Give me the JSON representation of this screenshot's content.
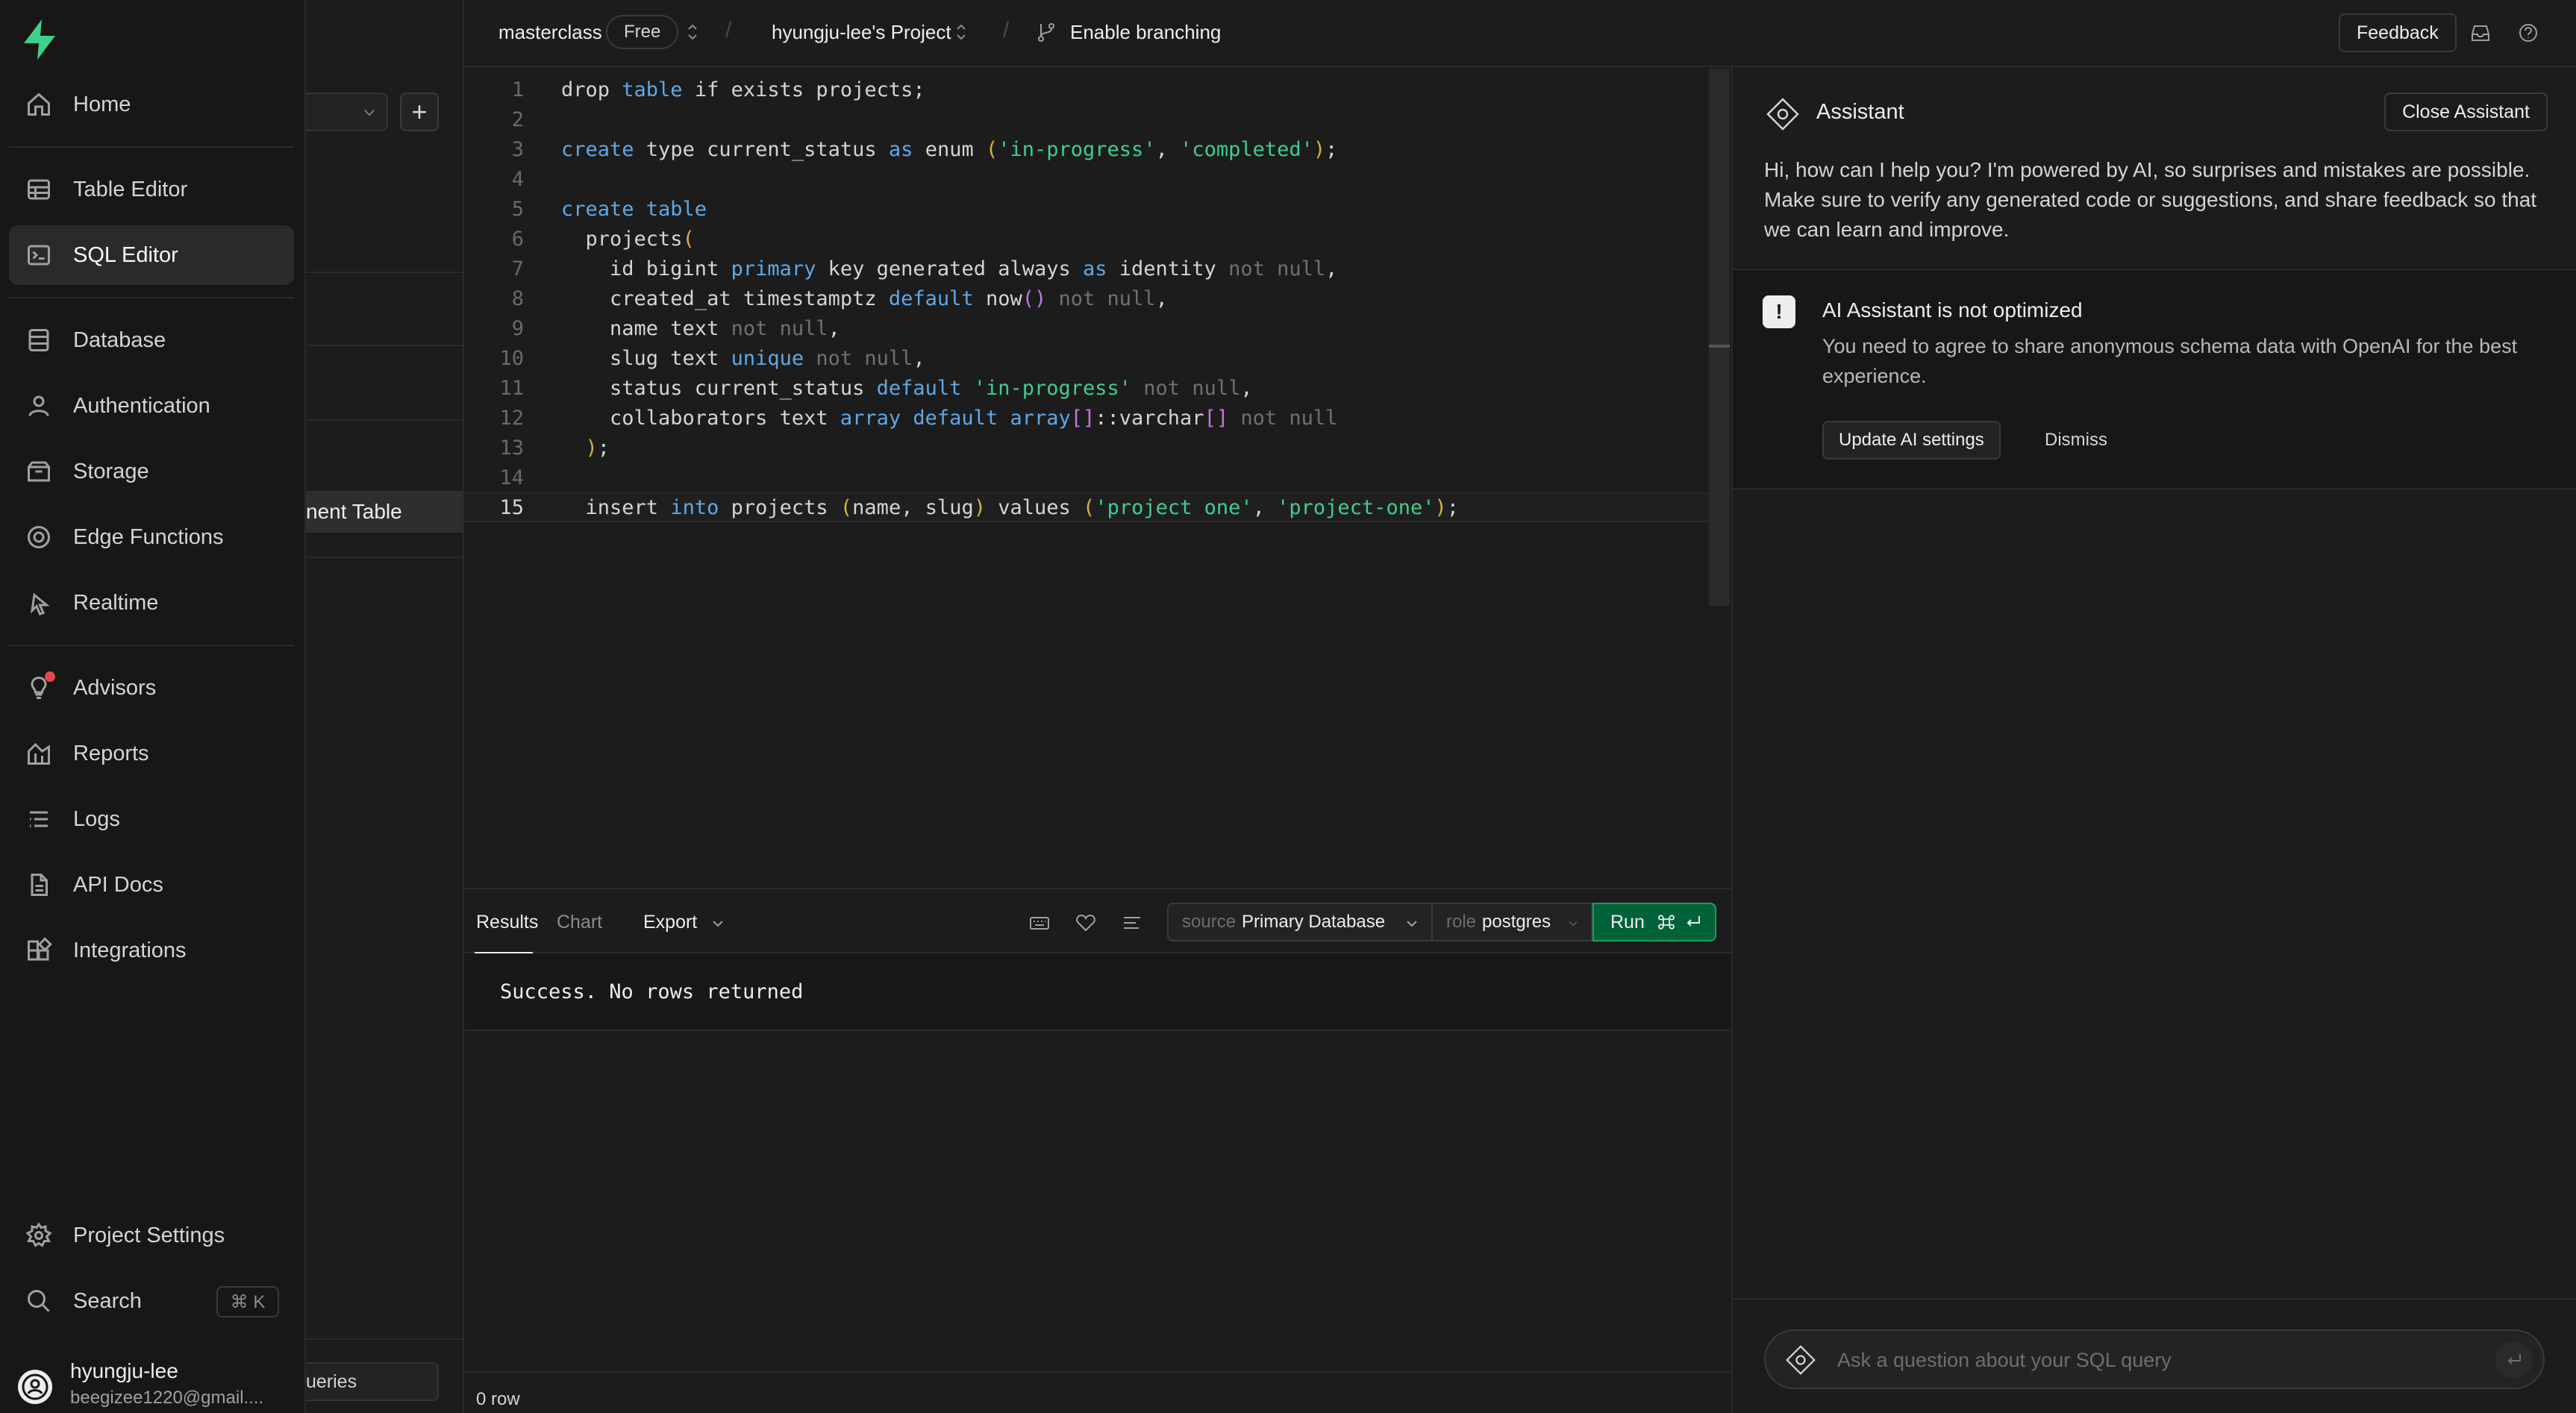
{
  "nav": {
    "items": [
      {
        "label": "Home",
        "icon": "home-icon"
      },
      {
        "label": "Table Editor",
        "icon": "table-icon"
      },
      {
        "label": "SQL Editor",
        "icon": "terminal-icon"
      },
      {
        "label": "Database",
        "icon": "database-icon"
      },
      {
        "label": "Authentication",
        "icon": "user-icon"
      },
      {
        "label": "Storage",
        "icon": "archive-icon"
      },
      {
        "label": "Edge Functions",
        "icon": "globe-icon"
      },
      {
        "label": "Realtime",
        "icon": "pointer-icon"
      },
      {
        "label": "Advisors",
        "icon": "lightbulb-icon"
      },
      {
        "label": "Reports",
        "icon": "chart-icon"
      },
      {
        "label": "Logs",
        "icon": "list-icon"
      },
      {
        "label": "API Docs",
        "icon": "file-icon"
      },
      {
        "label": "Integrations",
        "icon": "grid-icon"
      }
    ],
    "settings_label": "Project Settings",
    "search_label": "Search",
    "search_shortcut": "⌘ K",
    "user_name": "hyungju-lee",
    "user_email": "beegizee1220@gmail...."
  },
  "subpanel": {
    "active_item": "nent Table",
    "queries_label": "ueries"
  },
  "topbar": {
    "org": "masterclass",
    "plan_badge": "Free",
    "project": "hyungju-lee's Project",
    "branching": "Enable branching",
    "feedback": "Feedback"
  },
  "editor": {
    "lines": [
      {
        "n": "1"
      },
      {
        "n": "2"
      },
      {
        "n": "3"
      },
      {
        "n": "4"
      },
      {
        "n": "5"
      },
      {
        "n": "6"
      },
      {
        "n": "7"
      },
      {
        "n": "8"
      },
      {
        "n": "9"
      },
      {
        "n": "10"
      },
      {
        "n": "11"
      },
      {
        "n": "12"
      },
      {
        "n": "13"
      },
      {
        "n": "14"
      },
      {
        "n": "15"
      }
    ]
  },
  "results": {
    "tab_results": "Results",
    "tab_chart": "Chart",
    "export": "Export",
    "source_label": "source",
    "source_value": "Primary Database",
    "role_label": "role",
    "role_value": "postgres",
    "run": "Run",
    "message": "Success. No rows returned",
    "row_count": "0 row"
  },
  "assistant": {
    "title": "Assistant",
    "close": "Close Assistant",
    "intro": "Hi, how can I help you? I'm powered by AI, so surprises and mistakes are possible. Make sure to verify any generated code or suggestions, and share feedback so that we can learn and improve.",
    "warn_title": "AI Assistant is not optimized",
    "warn_body": "You need to agree to share anonymous schema data with OpenAI for the best experience.",
    "update_btn": "Update AI settings",
    "dismiss": "Dismiss",
    "input_placeholder": "Ask a question about your SQL query"
  },
  "colors": {
    "background": "#1c1c1c",
    "sidebar": "#171717",
    "brand": "#3ecf8e",
    "run_button": "#006239",
    "keyword": "#5fa8e6",
    "string": "#3ecf8e"
  }
}
